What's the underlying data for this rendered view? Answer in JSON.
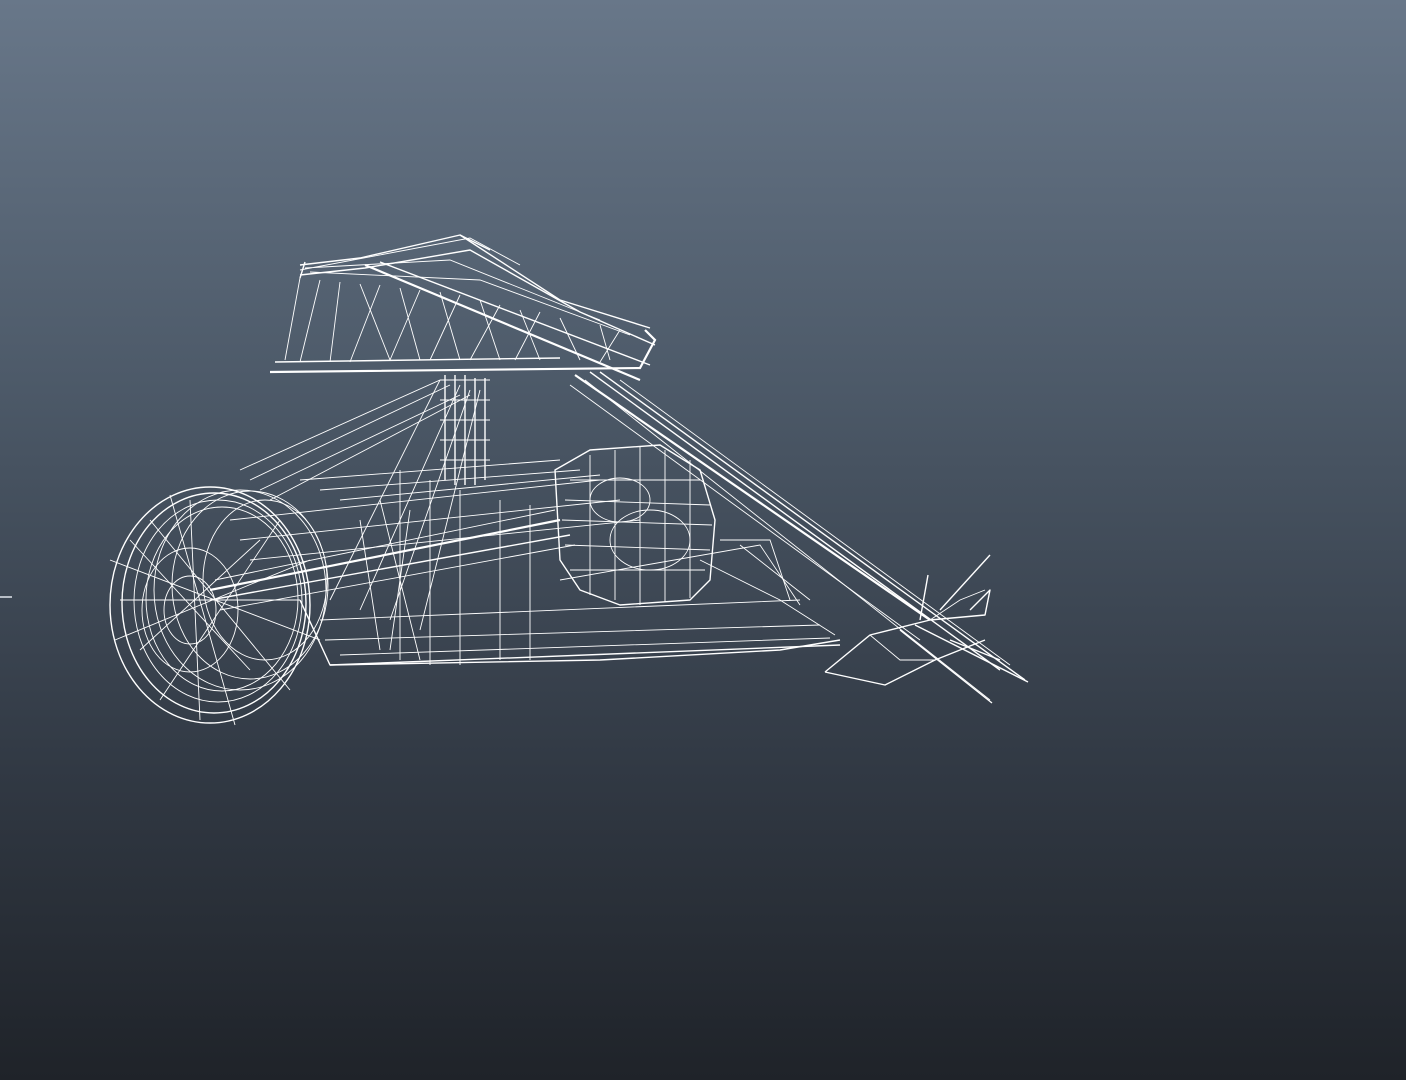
{
  "viewport": {
    "background_top": "#687789",
    "background_bottom": "#1f2329",
    "wire_color": "#ffffff",
    "render_mode": "wireframe"
  },
  "model": {
    "icon": "wireframe-chopper-motorcycle-icon"
  },
  "gizmo": {
    "icon": "axis-tick-icon",
    "color": "#b8bec6"
  }
}
